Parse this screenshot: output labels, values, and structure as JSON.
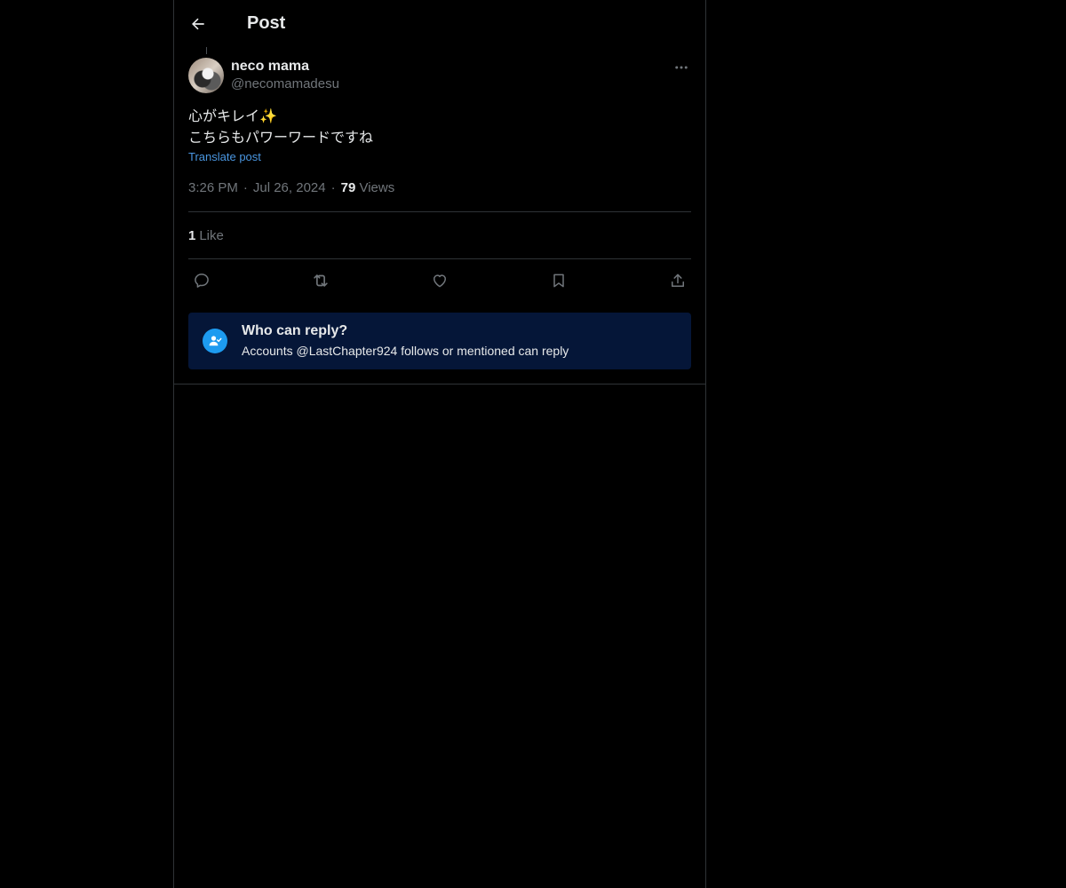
{
  "header": {
    "title": "Post"
  },
  "post": {
    "author": {
      "display_name": "neco mama",
      "handle": "@necomamadesu"
    },
    "text_lines": [
      "心がキレイ✨",
      "こちらもパワーワードですね"
    ],
    "translate_label": "Translate post",
    "time": "3:26 PM",
    "date": "Jul 26, 2024",
    "views_count": "79",
    "views_label": "Views",
    "likes_count": "1",
    "likes_label": "Like"
  },
  "actions": {
    "icons": [
      "reply-icon",
      "repost-icon",
      "like-icon",
      "bookmark-icon",
      "share-icon"
    ]
  },
  "reply_restriction": {
    "title": "Who can reply?",
    "description": "Accounts @LastChapter924 follows or mentioned can reply"
  },
  "colors": {
    "background": "#000000",
    "text": "#e7e9ea",
    "muted": "#71767b",
    "link": "#4a96e0",
    "accent": "#1d9bf0",
    "reply_box_bg": "#051638",
    "border": "#2f3336"
  }
}
